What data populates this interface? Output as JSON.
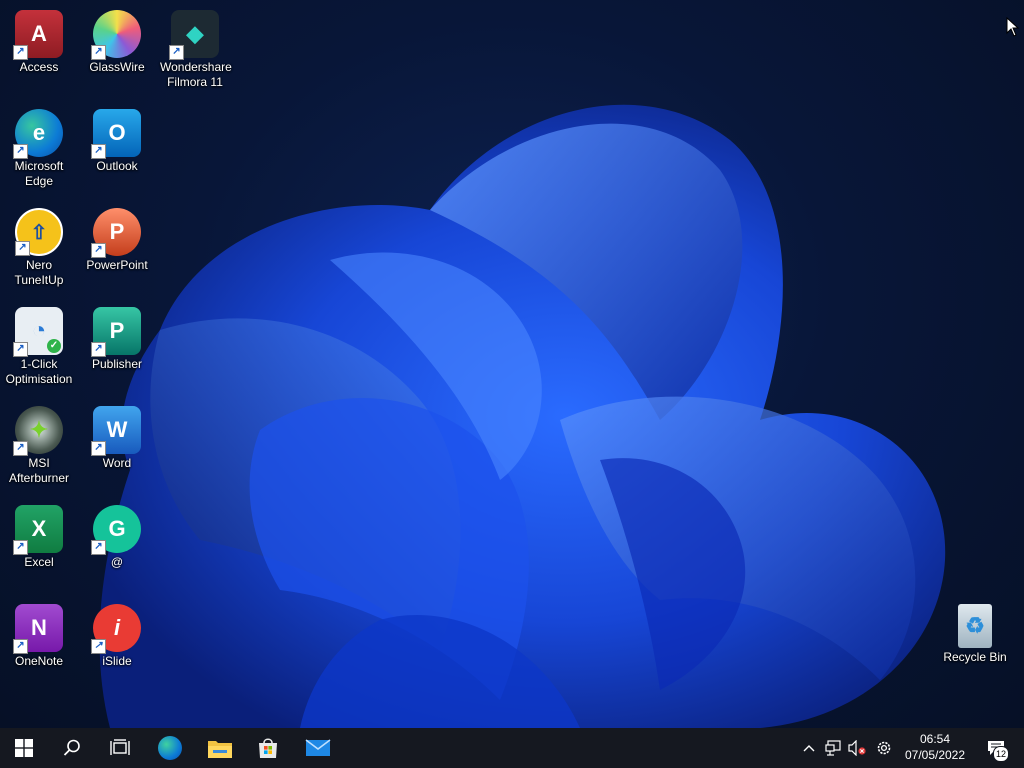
{
  "desktop": {
    "icons": [
      {
        "label": "Access",
        "name": "access-icon"
      },
      {
        "label": "GlassWire",
        "name": "glasswire-icon"
      },
      {
        "label": "Wondershare Filmora 11",
        "name": "filmora-icon"
      },
      {
        "label": "Microsoft Edge",
        "name": "edge-icon"
      },
      {
        "label": "Outlook",
        "name": "outlook-icon"
      },
      {
        "label": "Nero TuneItUp",
        "name": "nero-tuneitup-icon"
      },
      {
        "label": "PowerPoint",
        "name": "powerpoint-icon"
      },
      {
        "label": "1-Click Optimisation",
        "name": "one-click-optimisation-icon"
      },
      {
        "label": "Publisher",
        "name": "publisher-icon"
      },
      {
        "label": "MSI Afterburner",
        "name": "msi-afterburner-icon"
      },
      {
        "label": "Word",
        "name": "word-icon"
      },
      {
        "label": "Excel",
        "name": "excel-icon"
      },
      {
        "label": "@",
        "name": "grammarly-icon"
      },
      {
        "label": "OneNote",
        "name": "onenote-icon"
      },
      {
        "label": "iSlide",
        "name": "islide-icon"
      },
      {
        "label": "Recycle Bin",
        "name": "recycle-bin-icon"
      }
    ],
    "wallpaper": "windows-11-bloom",
    "colors": {
      "accent": "#1f4fe0",
      "background": "#081638"
    }
  },
  "taskbar": {
    "pinned": [
      {
        "name": "start-icon"
      },
      {
        "name": "search-icon"
      },
      {
        "name": "task-view-icon"
      },
      {
        "name": "edge-icon"
      },
      {
        "name": "file-explorer-icon"
      },
      {
        "name": "microsoft-store-icon"
      },
      {
        "name": "mail-icon"
      }
    ],
    "tray": {
      "icons": [
        "chevron-up-icon",
        "network-icon",
        "volume-muted-icon",
        "settings-gear-icon"
      ],
      "time": "06:54",
      "date": "07/05/2022",
      "notification_count": "12"
    }
  }
}
